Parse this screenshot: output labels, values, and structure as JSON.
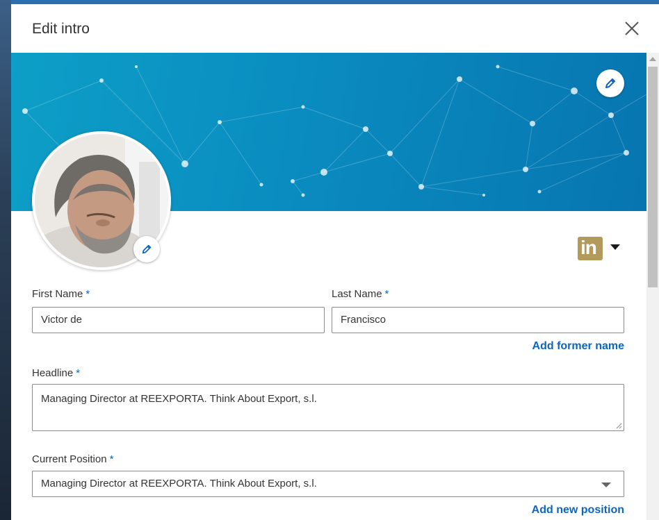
{
  "modal": {
    "title": "Edit intro",
    "close_icon": "close-icon"
  },
  "banner": {
    "edit_icon": "pencil-icon"
  },
  "profile": {
    "photo_edit_icon": "pencil-icon",
    "network_badge_text": "in",
    "network_icon": "linkedin-icon"
  },
  "form": {
    "required_marker": "*",
    "first_name": {
      "label": "First Name",
      "value": "Victor de"
    },
    "last_name": {
      "label": "Last Name",
      "value": "Francisco"
    },
    "add_former_name": "Add former name",
    "headline": {
      "label": "Headline",
      "value": "Managing Director at REEXPORTA. Think About Export, s.l."
    },
    "current_position": {
      "label": "Current Position",
      "value": "Managing Director at REEXPORTA. Think About Export, s.l."
    },
    "add_new_position": "Add new position"
  },
  "colors": {
    "accent": "#0a66c2",
    "banner": "#0a8cc0",
    "linkedin_badge": "#b29a5a"
  }
}
